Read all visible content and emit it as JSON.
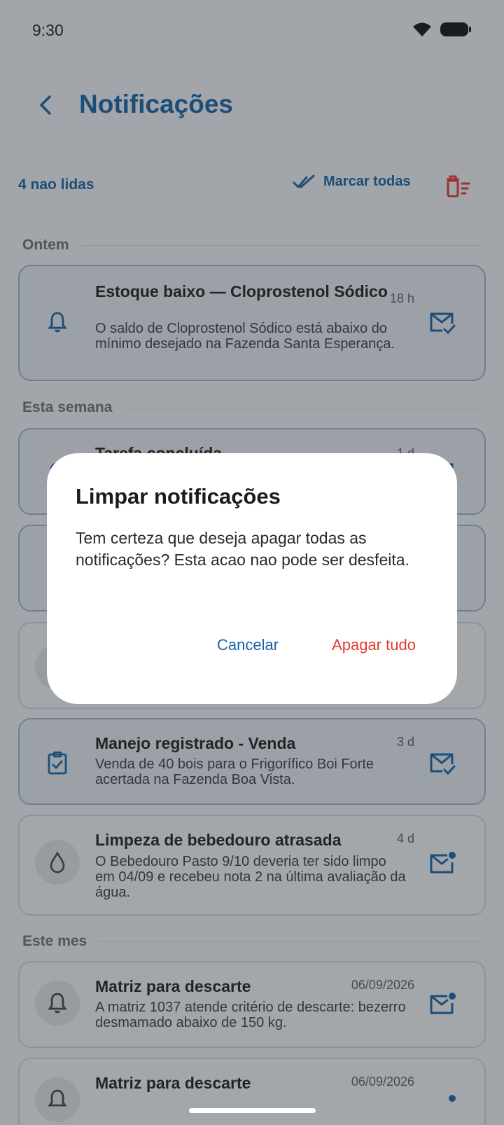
{
  "status_bar": {
    "time": "9:30",
    "wifi_icon": "wifi-icon",
    "battery_icon": "battery-icon"
  },
  "header": {
    "back_icon": "chevron-left-icon",
    "title": "Notificações"
  },
  "actions": {
    "unread_count": "4 nao lidas",
    "mark_all_label": "Marcar todas",
    "mark_all_icon": "double-check-icon",
    "delete_all_icon": "delete-sweep-icon"
  },
  "sections": {
    "yesterday": "Ontem",
    "this_week": "Esta semana",
    "this_month": "Este mes"
  },
  "notifications": [
    {
      "title": "Estoque baixo — Cloprostenol Sódico",
      "time": "18 h",
      "body": "O saldo de Cloprostenol Sódico está abaixo do mínimo desejado na Fazenda Santa Esperança.",
      "icon": "bell-icon",
      "status": "unread"
    },
    {
      "title": "Tarefa concluída",
      "time": "1 d",
      "body": "",
      "icon": "sync-icon",
      "status": "unread"
    },
    {
      "title": "",
      "time": "",
      "body": "",
      "icon": "info-icon",
      "status": "unread"
    },
    {
      "title": "",
      "time": "",
      "body": "",
      "icon": "bell-icon",
      "status": "read"
    },
    {
      "title": "Manejo registrado - Venda",
      "time": "3 d",
      "body": "Venda de 40 bois para o Frigorífico Boi Forte acertada na Fazenda Boa Vista.",
      "icon": "clipboard-check-icon",
      "status": "unread"
    },
    {
      "title": "Limpeza de bebedouro atrasada",
      "time": "4 d",
      "body": "O Bebedouro Pasto 9/10 deveria ter sido limpo em 04/09 e recebeu nota 2 na última avaliação da água.",
      "icon": "water-drop-icon",
      "status": "read"
    },
    {
      "title": "Matriz para descarte",
      "time": "06/09/2026",
      "body": "A matriz 1037 atende critério de descarte: bezerro desmamado abaixo de 150 kg.",
      "icon": "bell-icon",
      "status": "read"
    },
    {
      "title": "Matriz para descarte",
      "time": "06/09/2026",
      "body": "",
      "icon": "bell-icon",
      "status": "read"
    }
  ],
  "dialog": {
    "title": "Limpar notificações",
    "message": "Tem certeza que deseja apagar todas as notificações? Esta acao nao pode ser desfeita.",
    "cancel_label": "Cancelar",
    "confirm_label": "Apagar tudo"
  },
  "colors": {
    "primary": "#1565a8",
    "danger": "#e53a2e",
    "scrim": "rgba(40,44,50,0.40)"
  }
}
